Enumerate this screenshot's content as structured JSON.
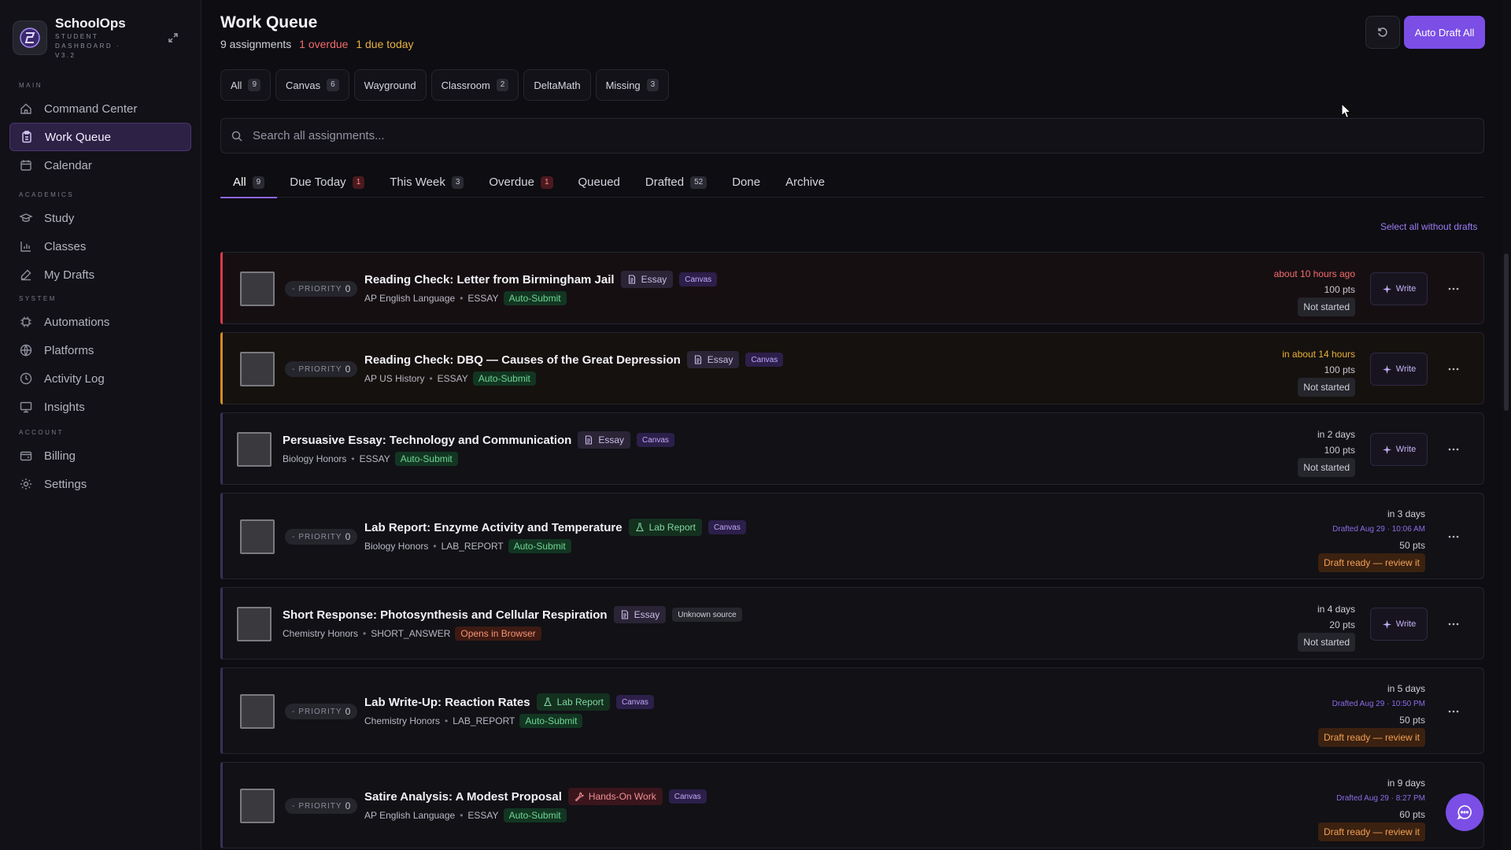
{
  "app": {
    "name": "SchoolOps",
    "subtitle": "STUDENT DASHBOARD · V3.2"
  },
  "sidebar": {
    "sections": [
      {
        "label": "MAIN",
        "items": [
          {
            "label": "Command Center",
            "icon": "home-icon",
            "active": false
          },
          {
            "label": "Work Queue",
            "icon": "clipboard-icon",
            "active": true
          },
          {
            "label": "Calendar",
            "icon": "calendar-icon",
            "active": false
          }
        ]
      },
      {
        "label": "ACADEMICS",
        "items": [
          {
            "label": "Study",
            "icon": "graduation-cap-icon",
            "active": false
          },
          {
            "label": "Classes",
            "icon": "bar-chart-icon",
            "active": false
          },
          {
            "label": "My Drafts",
            "icon": "edit-icon",
            "active": false
          }
        ]
      },
      {
        "label": "SYSTEM",
        "items": [
          {
            "label": "Automations",
            "icon": "cpu-icon",
            "active": false
          },
          {
            "label": "Platforms",
            "icon": "globe-icon",
            "active": false
          },
          {
            "label": "Activity Log",
            "icon": "clock-icon",
            "active": false
          },
          {
            "label": "Insights",
            "icon": "monitor-icon",
            "active": false
          }
        ]
      },
      {
        "label": "ACCOUNT",
        "items": [
          {
            "label": "Billing",
            "icon": "wallet-icon",
            "active": false
          },
          {
            "label": "Settings",
            "icon": "gear-icon",
            "active": false
          }
        ]
      }
    ]
  },
  "header": {
    "title": "Work Queue",
    "assignments": "9 assignments",
    "overdue": "1 overdue",
    "due_today": "1 due today",
    "auto_draft_label": "Auto Draft All"
  },
  "source_filters": [
    {
      "label": "All",
      "count": "9"
    },
    {
      "label": "Canvas",
      "count": "6"
    },
    {
      "label": "Wayground",
      "count": ""
    },
    {
      "label": "Classroom",
      "count": "2"
    },
    {
      "label": "DeltaMath",
      "count": ""
    },
    {
      "label": "Missing",
      "count": "3"
    }
  ],
  "search": {
    "placeholder": "Search all assignments..."
  },
  "tabs": [
    {
      "label": "All",
      "count": "9",
      "style": "neutral",
      "active": true
    },
    {
      "label": "Due Today",
      "count": "1",
      "style": "red",
      "active": false
    },
    {
      "label": "This Week",
      "count": "3",
      "style": "neutral",
      "active": false
    },
    {
      "label": "Overdue",
      "count": "1",
      "style": "red",
      "active": false
    },
    {
      "label": "Queued",
      "count": "",
      "style": "neutral",
      "active": false
    },
    {
      "label": "Drafted",
      "count": "52",
      "style": "neutral",
      "active": false
    },
    {
      "label": "Done",
      "count": "",
      "style": "neutral",
      "active": false
    },
    {
      "label": "Archive",
      "count": "",
      "style": "neutral",
      "active": false
    }
  ],
  "select_all_label": "Select all without drafts",
  "labels": {
    "priority": "PRIORITY",
    "write": "Write"
  },
  "assignments": [
    {
      "title": "Reading Check: Letter from Birmingham Jail",
      "type": "Essay",
      "type_style": "essay",
      "source": "Canvas",
      "source_style": "canvas",
      "course": "AP English Language",
      "kind": "ESSAY",
      "submit": "Auto-Submit",
      "submit_style": "auto",
      "priority": "0",
      "show_priority": true,
      "due": "about 10 hours ago",
      "due_style": "red",
      "drafted": "",
      "points": "100 pts",
      "status": "Not started",
      "status_style": "not-started",
      "show_write": true,
      "accent": "red"
    },
    {
      "title": "Reading Check: DBQ — Causes of the Great Depression",
      "type": "Essay",
      "type_style": "essay",
      "source": "Canvas",
      "source_style": "canvas",
      "course": "AP US History",
      "kind": "ESSAY",
      "submit": "Auto-Submit",
      "submit_style": "auto",
      "priority": "0",
      "show_priority": true,
      "due": "in about 14 hours",
      "due_style": "amber",
      "drafted": "",
      "points": "100 pts",
      "status": "Not started",
      "status_style": "not-started",
      "show_write": true,
      "accent": "amber"
    },
    {
      "title": "Persuasive Essay: Technology and Communication",
      "type": "Essay",
      "type_style": "essay",
      "source": "Canvas",
      "source_style": "canvas",
      "course": "Biology Honors",
      "kind": "ESSAY",
      "submit": "Auto-Submit",
      "submit_style": "auto",
      "priority": "",
      "show_priority": false,
      "due": "in 2 days",
      "due_style": "normal",
      "drafted": "",
      "points": "100 pts",
      "status": "Not started",
      "status_style": "not-started",
      "show_write": true,
      "accent": "purple"
    },
    {
      "title": "Lab Report: Enzyme Activity and Temperature",
      "type": "Lab Report",
      "type_style": "lab",
      "source": "Canvas",
      "source_style": "canvas",
      "course": "Biology Honors",
      "kind": "LAB_REPORT",
      "submit": "Auto-Submit",
      "submit_style": "auto",
      "priority": "0",
      "show_priority": true,
      "due": "in 3 days",
      "due_style": "normal",
      "drafted": "Drafted Aug 29 · 10:06 AM",
      "points": "50 pts",
      "status": "Draft ready — review it",
      "status_style": "draft-ready",
      "show_write": false,
      "accent": "purple"
    },
    {
      "title": "Short Response: Photosynthesis and Cellular Respiration",
      "type": "Essay",
      "type_style": "essay",
      "source": "Unknown source",
      "source_style": "unknown",
      "course": "Chemistry Honors",
      "kind": "SHORT_ANSWER",
      "submit": "Opens in Browser",
      "submit_style": "browser",
      "priority": "",
      "show_priority": false,
      "due": "in 4 days",
      "due_style": "normal",
      "drafted": "",
      "points": "20 pts",
      "status": "Not started",
      "status_style": "not-started",
      "show_write": true,
      "accent": "purple"
    },
    {
      "title": "Lab Write-Up: Reaction Rates",
      "type": "Lab Report",
      "type_style": "lab",
      "source": "Canvas",
      "source_style": "canvas",
      "course": "Chemistry Honors",
      "kind": "LAB_REPORT",
      "submit": "Auto-Submit",
      "submit_style": "auto",
      "priority": "0",
      "show_priority": true,
      "due": "in 5 days",
      "due_style": "normal",
      "drafted": "Drafted Aug 29 · 10:50 PM",
      "points": "50 pts",
      "status": "Draft ready — review it",
      "status_style": "draft-ready",
      "show_write": false,
      "accent": "purple"
    },
    {
      "title": "Satire Analysis: A Modest Proposal",
      "type": "Hands-On Work",
      "type_style": "hands",
      "source": "Canvas",
      "source_style": "canvas",
      "course": "AP English Language",
      "kind": "ESSAY",
      "submit": "Auto-Submit",
      "submit_style": "auto",
      "priority": "0",
      "show_priority": true,
      "due": "in 9 days",
      "due_style": "normal",
      "drafted": "Drafted Aug 29 · 8:27 PM",
      "points": "60 pts",
      "status": "Draft ready — review it",
      "status_style": "draft-ready",
      "show_write": false,
      "accent": "purple"
    }
  ],
  "colors": {
    "accent": "#7b4ee6",
    "overdue": "#f26b6b",
    "due_soon": "#e8b240",
    "success": "#6fd693"
  }
}
